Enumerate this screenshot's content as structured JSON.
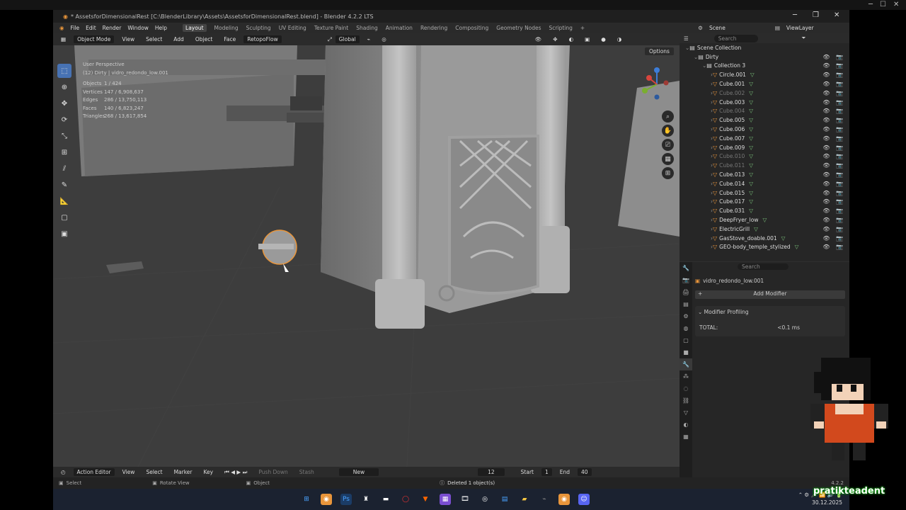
{
  "window": {
    "title": "* AssetsforDimensionalRest [C:\\BlenderLibrary\\Assets\\AssetsforDimensionalRest.blend] - Blender 4.2.2 LTS",
    "min": "─",
    "max": "❐",
    "close": "✕"
  },
  "menu": [
    "File",
    "Edit",
    "Render",
    "Window",
    "Help"
  ],
  "workspaces": [
    "Layout",
    "Modeling",
    "Sculpting",
    "UV Editing",
    "Texture Paint",
    "Shading",
    "Animation",
    "Rendering",
    "Compositing",
    "Geometry Nodes",
    "Scripting",
    "+"
  ],
  "scene": {
    "label": "Scene",
    "viewlayer": "ViewLayer"
  },
  "viewport_header": {
    "mode": "Object Mode",
    "view": "View",
    "select": "Select",
    "add": "Add",
    "object": "Object",
    "face": "Face",
    "retopo": "RetopoFlow",
    "orientation": "Global",
    "options": "Options"
  },
  "overlay": {
    "perspective": "User Perspective",
    "context": "(12) Dirty | vidro_redondo_low.001",
    "stats": [
      {
        "k": "Objects",
        "v": "1 / 424"
      },
      {
        "k": "Vertices",
        "v": "147 / 6,908,637"
      },
      {
        "k": "Edges",
        "v": "286 / 13,750,113"
      },
      {
        "k": "Faces",
        "v": "140 / 6,823,247"
      },
      {
        "k": "Triangles",
        "v": "268 / 13,617,854"
      }
    ]
  },
  "outliner": {
    "search": "Search",
    "rows": [
      {
        "name": "Scene Collection",
        "indent": 0,
        "dim": false
      },
      {
        "name": "Dirty",
        "indent": 1,
        "dim": false
      },
      {
        "name": "Collection 3",
        "indent": 2,
        "dim": false
      },
      {
        "name": "Circle.001",
        "indent": 3,
        "dim": false
      },
      {
        "name": "Cube.001",
        "indent": 3,
        "dim": false
      },
      {
        "name": "Cube.002",
        "indent": 3,
        "dim": true
      },
      {
        "name": "Cube.003",
        "indent": 3,
        "dim": false
      },
      {
        "name": "Cube.004",
        "indent": 3,
        "dim": true
      },
      {
        "name": "Cube.005",
        "indent": 3,
        "dim": false
      },
      {
        "name": "Cube.006",
        "indent": 3,
        "dim": false
      },
      {
        "name": "Cube.007",
        "indent": 3,
        "dim": false
      },
      {
        "name": "Cube.009",
        "indent": 3,
        "dim": false
      },
      {
        "name": "Cube.010",
        "indent": 3,
        "dim": true
      },
      {
        "name": "Cube.011",
        "indent": 3,
        "dim": true
      },
      {
        "name": "Cube.013",
        "indent": 3,
        "dim": false
      },
      {
        "name": "Cube.014",
        "indent": 3,
        "dim": false
      },
      {
        "name": "Cube.015",
        "indent": 3,
        "dim": false
      },
      {
        "name": "Cube.017",
        "indent": 3,
        "dim": false
      },
      {
        "name": "Cube.031",
        "indent": 3,
        "dim": false
      },
      {
        "name": "DeepFryer_low",
        "indent": 3,
        "dim": false
      },
      {
        "name": "ElectricGrill",
        "indent": 3,
        "dim": false
      },
      {
        "name": "GasStove_doable.001",
        "indent": 3,
        "dim": false
      },
      {
        "name": "GEO-body_temple_stylized",
        "indent": 3,
        "dim": false
      }
    ]
  },
  "properties": {
    "search": "Search",
    "object": "vidro_redondo_low.001",
    "add_modifier": "Add Modifier",
    "panel": "Modifier Profiling",
    "total_label": "TOTAL:",
    "total_value": "<0.1 ms"
  },
  "timeline": {
    "editor": "Action Editor",
    "view": "View",
    "select": "Select",
    "marker": "Marker",
    "key": "Key",
    "push_down": "Push Down",
    "stash": "Stash",
    "new": "New",
    "frame": "12",
    "start_label": "Start",
    "start": "1",
    "end_label": "End",
    "end": "40"
  },
  "status": {
    "select": "Select",
    "rotate": "Rotate View",
    "object": "Object",
    "message": "Deleted 1 object(s)",
    "version": "4.2.2"
  },
  "taskbar": {
    "time": "",
    "date": "30.12.2025"
  },
  "streamer": "pratikteadent"
}
